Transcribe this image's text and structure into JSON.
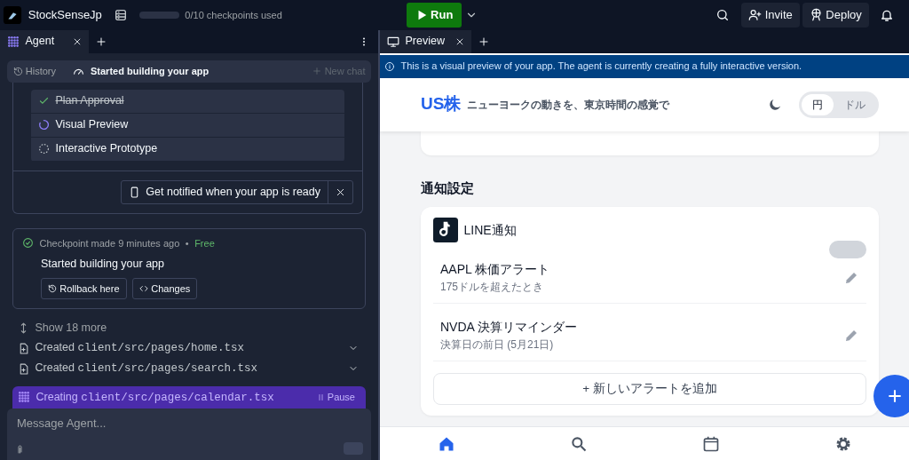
{
  "topbar": {
    "app_name": "StockSenseJp",
    "checkpoints": {
      "text": "0/10 checkpoints used",
      "level": 0
    },
    "run_label": "Run",
    "actions": [
      "Invite",
      "Deploy"
    ]
  },
  "agent_tabs": [
    {
      "label": "Agent",
      "selected": true
    }
  ],
  "chat_header": {
    "history": "History",
    "title": "Started building your app",
    "new_chat": "New chat"
  },
  "steps": [
    {
      "label": "Plan Approval",
      "kind": "done"
    },
    {
      "label": "Visual Preview",
      "kind": "active"
    },
    {
      "label": "Interactive Prototype",
      "kind": "pending"
    }
  ],
  "notify": "Get notified when your app is ready",
  "checkpoint": {
    "meta": "Checkpoint made 9 minutes ago",
    "separator": "•",
    "badge": "Free",
    "title": "Started building your app",
    "buttons": [
      {
        "kind": "rollback",
        "label": "Rollback here"
      },
      {
        "kind": "changes",
        "label": "Changes"
      }
    ]
  },
  "show_more": "Show 18 more",
  "files": [
    {
      "verb": "Created",
      "path": "client/src/pages/home.tsx"
    },
    {
      "verb": "Created",
      "path": "client/src/pages/search.tsx"
    }
  ],
  "current": {
    "verb": "Creating",
    "path": "client/src/pages/calendar.tsx",
    "action": "Pause"
  },
  "message": {
    "placeholder": "Message Agent..."
  },
  "preview_tabs": [
    {
      "label": "Preview",
      "selected": true
    }
  ],
  "preview": {
    "banner": "This is a visual preview of your app. The agent is currently creating a fully interactive version.",
    "logo": "US株",
    "tagline": "ニューヨークの動きを、東京時間の感覚で",
    "currency": [
      {
        "label": "円",
        "selected": true
      },
      {
        "label": "ドル",
        "selected": false
      }
    ],
    "section_title": "通知設定",
    "channel": {
      "name": "LINE通知",
      "on": false
    },
    "alerts": [
      {
        "title": "AAPL 株価アラート",
        "subtitle": "175ドルを超えたとき"
      },
      {
        "title": "NVDA 決算リマインダー",
        "subtitle": "決算日の前日 (5月21日)"
      }
    ],
    "add_button": "+ 新しいアラートを追加",
    "nav": [
      {
        "kind": "home",
        "selected": true
      },
      {
        "kind": "search",
        "selected": false
      },
      {
        "kind": "calendar",
        "selected": false
      },
      {
        "kind": "settings",
        "selected": false
      }
    ]
  }
}
